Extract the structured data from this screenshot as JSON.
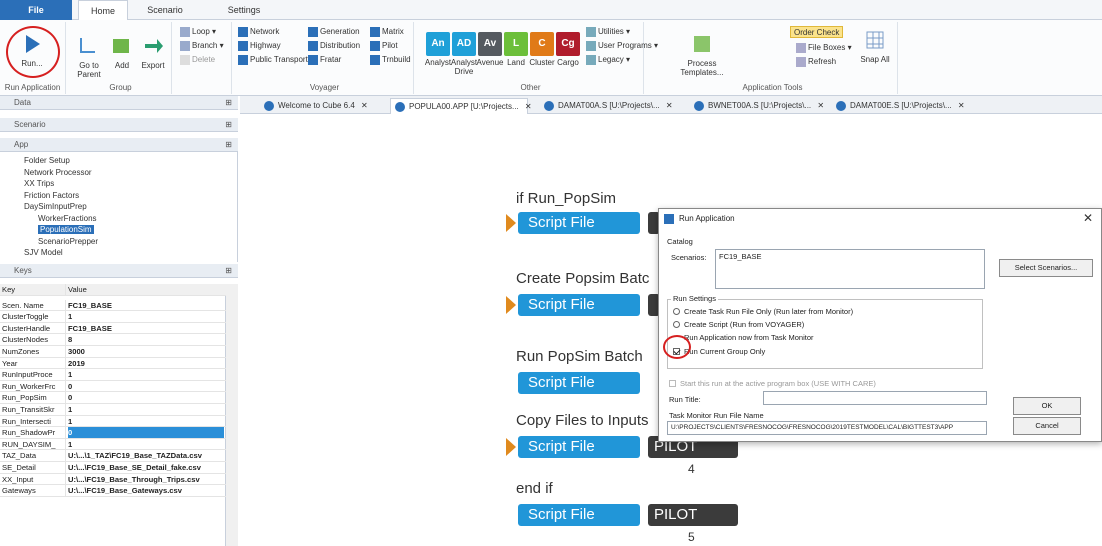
{
  "menu": {
    "file": "File",
    "home": "Home",
    "scenario": "Scenario",
    "settings": "Settings"
  },
  "ribbon": {
    "run_label": "Run...",
    "run_group": "Run Application",
    "go_to_parent": "Go to Parent",
    "add": "Add",
    "export": "Export",
    "loop": "Loop",
    "branch": "Branch",
    "delete": "Delete",
    "group_label": "Group",
    "network": "Network",
    "highway": "Highway",
    "public_transport": "Public Transport",
    "generation": "Generation",
    "distribution": "Distribution",
    "fratar": "Fratar",
    "matrix": "Matrix",
    "pilot": "Pilot",
    "tribuild": "Trnbuild",
    "voyager_label": "Voyager",
    "tiles": [
      {
        "abbr": "An",
        "label": "Analyst",
        "color": "#1fa0d8"
      },
      {
        "abbr": "AD",
        "label": "Analyst Drive",
        "color": "#1fa0d8"
      },
      {
        "abbr": "Av",
        "label": "Avenue",
        "color": "#555a60"
      },
      {
        "abbr": "L",
        "label": "Land",
        "color": "#6cbf3a"
      },
      {
        "abbr": "C",
        "label": "Cluster",
        "color": "#e07a18"
      },
      {
        "abbr": "Cg",
        "label": "Cargo",
        "color": "#b01c2c"
      }
    ],
    "utilities": "Utilities",
    "user_programs": "User Programs",
    "legacy": "Legacy",
    "other_label": "Other",
    "process_templates": "Process Templates...",
    "order_check": "Order Check",
    "file_boxes": "File Boxes",
    "refresh": "Refresh",
    "snap_all": "Snap All",
    "app_tools_label": "Application Tools"
  },
  "panels": {
    "data": "Data",
    "scenario": "Scenario",
    "app": "App",
    "keys": "Keys"
  },
  "tree": [
    {
      "label": "Folder Setup",
      "indent": 0
    },
    {
      "label": "Network Processor",
      "indent": 0
    },
    {
      "label": "XX Trips",
      "indent": 0
    },
    {
      "label": "Friction Factors",
      "indent": 0
    },
    {
      "label": "DaySimInputPrep",
      "indent": 0
    },
    {
      "label": "WorkerFractions",
      "indent": 1
    },
    {
      "label": "PopulationSim",
      "indent": 1
    },
    {
      "label": "ScenarioPrepper",
      "indent": 1
    },
    {
      "label": "SJV Model",
      "indent": 0
    }
  ],
  "keys": {
    "header_key": "Key",
    "header_value": "Value",
    "rows": [
      {
        "k": "Scen. Name",
        "v": "FC19_BASE"
      },
      {
        "k": "ClusterToggle",
        "v": "1"
      },
      {
        "k": "ClusterHandle",
        "v": "FC19_BASE"
      },
      {
        "k": "ClusterNodes",
        "v": "8"
      },
      {
        "k": "NumZones",
        "v": "3000"
      },
      {
        "k": "Year",
        "v": "2019"
      },
      {
        "k": "RunInputProce",
        "v": "1"
      },
      {
        "k": "Run_WorkerFrc",
        "v": "0"
      },
      {
        "k": "Run_PopSim",
        "v": "0"
      },
      {
        "k": "Run_TransitSkr",
        "v": "1"
      },
      {
        "k": "Run_Intersecti",
        "v": "1"
      },
      {
        "k": "Run_ShadowPr",
        "v": "0"
      },
      {
        "k": "RUN_DAYSIM_",
        "v": "1"
      },
      {
        "k": "TAZ_Data",
        "v": "U:\\...\\1_TAZ\\FC19_Base_TAZData.csv"
      },
      {
        "k": "SE_Detail",
        "v": "U:\\...\\FC19_Base_SE_Detail_fake.csv"
      },
      {
        "k": "XX_Input",
        "v": "U:\\...\\FC19_Base_Through_Trips.csv"
      },
      {
        "k": "Gateways",
        "v": "U:\\...\\FC19_Base_Gateways.csv"
      }
    ]
  },
  "doc_tabs": [
    {
      "label": "Welcome to Cube 6.4"
    },
    {
      "label": "POPULA00.APP [U:\\Projects..."
    },
    {
      "label": "DAMAT00A.S [U:\\Projects\\..."
    },
    {
      "label": "BWNET00A.S [U:\\Projects\\..."
    },
    {
      "label": "DAMAT00E.S [U:\\Projects\\..."
    }
  ],
  "canvas": {
    "if_run": "if Run_PopSim",
    "create_batch": "Create Popsim Batc",
    "run_batch": "Run PopSim Batch",
    "copy_files": "Copy Files to Inputs",
    "end_if": "end if",
    "script_file": "Script File",
    "pilot": "PILOT",
    "num4": "4",
    "num5": "5"
  },
  "dialog": {
    "title": "Run Application",
    "catalog": "Catalog",
    "scenarios_label": "Scenarios:",
    "scenarios_value": "FC19_BASE",
    "select_scenarios": "Select Scenarios...",
    "run_settings": "Run Settings",
    "opt1": "Create Task Run File Only (Run later from Monitor)",
    "opt2": "Create Script (Run from VOYAGER)",
    "opt3": "Run Application now from Task Monitor",
    "opt4": "Run Current Group Only",
    "start_active": "Start this run at the active program box (USE WITH CARE)",
    "run_title": "Run Title:",
    "monitor_file_label": "Task Monitor Run File Name",
    "monitor_file_value": "U:\\PROJECTS\\CLIENTS\\FRESNOCOG\\FRESNOCOG\\2019TESTMODEL\\CAL\\BIGTTEST3\\APP",
    "ok": "OK",
    "cancel": "Cancel"
  }
}
